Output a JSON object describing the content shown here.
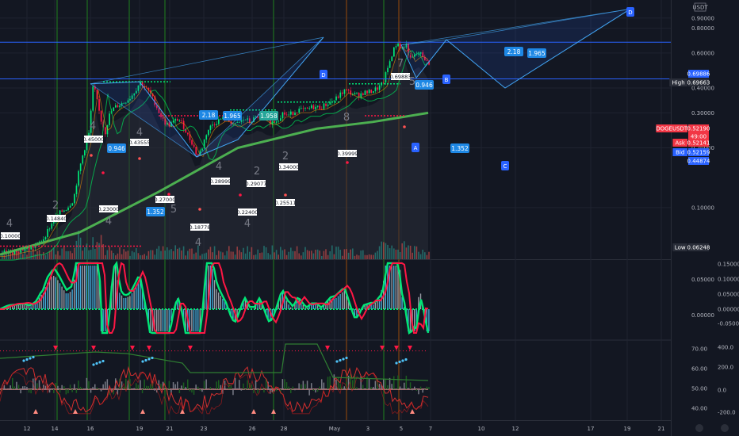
{
  "chart_data": {
    "type": "candlestick",
    "symbol": "DOGEUSDT",
    "currency_badge": "USDT",
    "x_axis": {
      "labels": [
        "12",
        "14",
        "16",
        "19",
        "21",
        "23",
        "26",
        "28",
        "May",
        "3",
        "5",
        "7",
        "10",
        "12",
        "17",
        "19",
        "21"
      ],
      "label_x": [
        34,
        69,
        114,
        176,
        214,
        257,
        318,
        358,
        422,
        464,
        506,
        543,
        607,
        650,
        745,
        791,
        834
      ],
      "ticks_visible": true
    },
    "main_pane": {
      "scale": "log",
      "ylim": [
        0.055,
        1.05
      ],
      "y_ticks": [
        "0.90000",
        "0.80000",
        "0.60000",
        "0.40000",
        "0.30000",
        "0.20000",
        "0.10000"
      ],
      "y_tick_values": [
        0.9,
        0.8,
        0.6,
        0.4,
        0.3,
        0.2,
        0.1
      ],
      "price_tags": [
        {
          "label": "High",
          "value": "0.69663",
          "color": "#2a2e39"
        },
        {
          "label": "",
          "value": "0.69886",
          "color": "#2962ff"
        },
        {
          "label": "DOGEUSDT",
          "value": "0.52190",
          "color": "#f23645"
        },
        {
          "label": "",
          "value": "49:00",
          "color": "#f23645"
        },
        {
          "label": "Ask",
          "value": "0.52141",
          "color": "#f23645"
        },
        {
          "label": "Bid",
          "value": "0.52159",
          "color": "#2962ff"
        },
        {
          "label": "",
          "value": "0.44874",
          "color": "#2962ff"
        },
        {
          "label": "Low",
          "value": "0.06248",
          "color": "#2a2e39"
        }
      ],
      "close_path": [
        [
          0,
          0.0585
        ],
        [
          8,
          0.0595
        ],
        [
          15,
          0.06
        ],
        [
          22,
          0.061
        ],
        [
          30,
          0.062
        ],
        [
          38,
          0.0625
        ],
        [
          46,
          0.065
        ],
        [
          54,
          0.07
        ],
        [
          62,
          0.08
        ],
        [
          70,
          0.09
        ],
        [
          76,
          0.095
        ],
        [
          84,
          0.1
        ],
        [
          92,
          0.11
        ],
        [
          100,
          0.16
        ],
        [
          106,
          0.2
        ],
        [
          112,
          0.24
        ],
        [
          117,
          0.42
        ],
        [
          121,
          0.35
        ],
        [
          126,
          0.28
        ],
        [
          132,
          0.24
        ],
        [
          138,
          0.3
        ],
        [
          144,
          0.32
        ],
        [
          150,
          0.33
        ],
        [
          156,
          0.34
        ],
        [
          164,
          0.36
        ],
        [
          170,
          0.39
        ],
        [
          176,
          0.43
        ],
        [
          182,
          0.4
        ],
        [
          188,
          0.38
        ],
        [
          194,
          0.34
        ],
        [
          200,
          0.3
        ],
        [
          206,
          0.27
        ],
        [
          212,
          0.26
        ],
        [
          218,
          0.27
        ],
        [
          224,
          0.28
        ],
        [
          230,
          0.26
        ],
        [
          236,
          0.23
        ],
        [
          242,
          0.21
        ],
        [
          248,
          0.18
        ],
        [
          254,
          0.2
        ],
        [
          260,
          0.24
        ],
        [
          266,
          0.26
        ],
        [
          272,
          0.27
        ],
        [
          278,
          0.28
        ],
        [
          284,
          0.28
        ],
        [
          290,
          0.27
        ],
        [
          296,
          0.26
        ],
        [
          302,
          0.27
        ],
        [
          308,
          0.28
        ],
        [
          314,
          0.27
        ],
        [
          320,
          0.28
        ],
        [
          326,
          0.29
        ],
        [
          332,
          0.28
        ],
        [
          338,
          0.27
        ],
        [
          344,
          0.27
        ],
        [
          350,
          0.28
        ],
        [
          356,
          0.3
        ],
        [
          362,
          0.29
        ],
        [
          368,
          0.3
        ],
        [
          374,
          0.31
        ],
        [
          380,
          0.31
        ],
        [
          386,
          0.31
        ],
        [
          392,
          0.32
        ],
        [
          398,
          0.32
        ],
        [
          404,
          0.32
        ],
        [
          410,
          0.33
        ],
        [
          416,
          0.34
        ],
        [
          422,
          0.35
        ],
        [
          428,
          0.37
        ],
        [
          434,
          0.39
        ],
        [
          440,
          0.38
        ],
        [
          446,
          0.37
        ],
        [
          452,
          0.37
        ],
        [
          458,
          0.38
        ],
        [
          464,
          0.38
        ],
        [
          470,
          0.39
        ],
        [
          476,
          0.4
        ],
        [
          482,
          0.42
        ],
        [
          488,
          0.5
        ],
        [
          494,
          0.6
        ],
        [
          500,
          0.68
        ],
        [
          506,
          0.63
        ],
        [
          512,
          0.66
        ],
        [
          516,
          0.55
        ],
        [
          522,
          0.58
        ],
        [
          528,
          0.6
        ],
        [
          534,
          0.57
        ],
        [
          540,
          0.52
        ]
      ],
      "ema_long": [
        [
          0,
          0.058
        ],
        [
          100,
          0.075
        ],
        [
          200,
          0.12
        ],
        [
          300,
          0.2
        ],
        [
          400,
          0.25
        ],
        [
          470,
          0.27
        ],
        [
          540,
          0.3
        ]
      ],
      "harmonic_patterns": [
        {
          "points": [
            [
              "X",
              114,
              0.42
            ],
            [
              "A",
              176,
              0.43
            ],
            [
              "B",
              248,
              0.18
            ],
            [
              "C",
              300,
              0.22
            ],
            [
              "D",
              408,
              0.72
            ]
          ],
          "ratios": [
            "2.18",
            "1.965",
            "1.958"
          ]
        },
        {
          "points": [
            [
              "X",
              506,
              0.66
            ],
            [
              "A",
              525,
              0.45
            ],
            [
              "B",
              563,
              0.7
            ],
            [
              "C",
              637,
              0.4
            ],
            [
              "D",
              795,
              1.0
            ]
          ],
          "ratios": [
            "0.946",
            "1.352",
            "2.18",
            "1.965"
          ]
        }
      ],
      "wave_labels": [
        "4",
        "2",
        "4",
        "4",
        "4",
        "2",
        "4",
        "4",
        "4",
        "5",
        "2",
        "8",
        "7",
        "5"
      ],
      "pivot_labels": [
        "0.45000",
        "0.43555",
        "0.14840",
        "0.10000",
        "0.23000",
        "0.27000",
        "0.28999",
        "0.22400",
        "0.29077",
        "0.18778",
        "0.34000",
        "0.39999",
        "0.69883",
        "0.25511"
      ],
      "fib_ratio_labels": [
        "0.946",
        "1.352",
        "2.18",
        "1.965",
        "1.958",
        "0.946",
        "1.352",
        "2.18",
        "1.965"
      ],
      "pattern_letters": [
        "A",
        "B",
        "C",
        "D",
        "D"
      ]
    },
    "macd_pane": {
      "y_ticks_left": [
        "0.05000",
        "0.00000"
      ],
      "y_ticks_right": [
        "0.15000",
        "0.10000",
        "0.05000",
        "0.00000",
        "-0.05000"
      ],
      "zero_line": 0.0
    },
    "osc_pane": {
      "y_ticks_left": [
        "70.00",
        "60.00",
        "50.00",
        "40.00"
      ],
      "y_ticks_right": [
        "400.0",
        "200.0",
        "0.0",
        "-200.0"
      ]
    },
    "colors": {
      "background": "#131722",
      "up": "#26a69a",
      "down": "#ef5350",
      "green": "#00e676",
      "red": "#ff1744",
      "grid": "#1f2330",
      "pattern": "#2962ff",
      "vertical_green": "#1b5e20",
      "vertical_brown": "#6d3a12"
    }
  }
}
